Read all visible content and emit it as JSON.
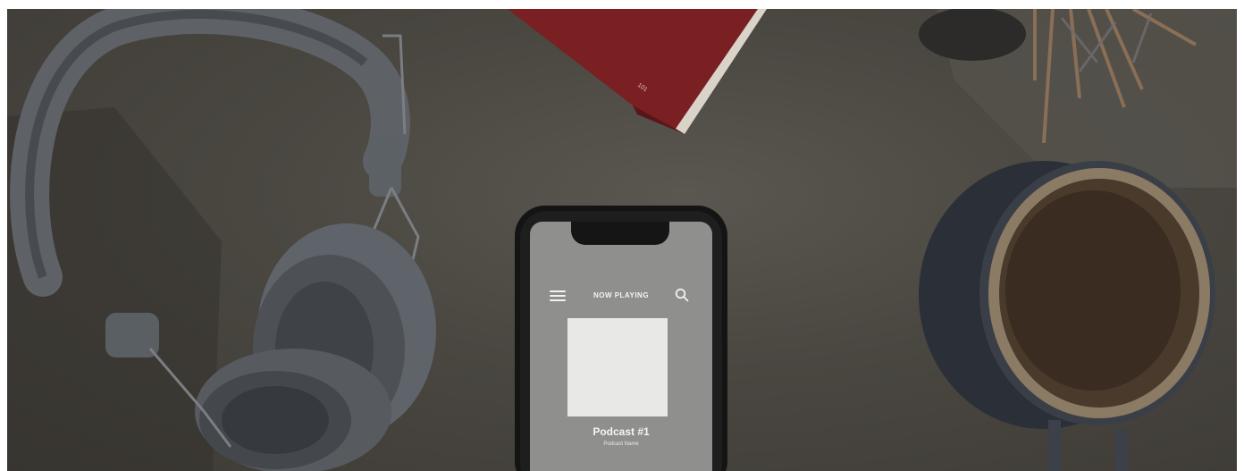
{
  "phone": {
    "header": {
      "title": "NOW PLAYING",
      "menu_icon": "menu-icon",
      "search_icon": "search-icon"
    },
    "track": {
      "title": "Podcast #1",
      "subtitle": "Podcast Name"
    }
  },
  "book": {
    "corner_number": "101"
  }
}
